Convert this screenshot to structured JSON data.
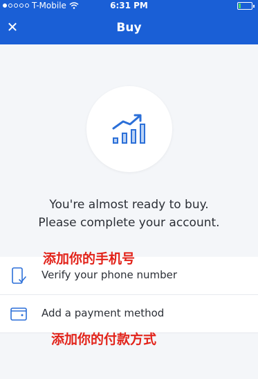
{
  "status_bar": {
    "carrier": "T-Mobile",
    "time": "6:31 PM"
  },
  "header": {
    "close_icon": "close-icon",
    "title": "Buy"
  },
  "hero_icon": "chart-growth-icon",
  "message": {
    "line1": "You're almost ready to buy.",
    "line2": "Please complete your account."
  },
  "annotations": {
    "phone": "添加你的手机号",
    "payment": "添加你的付款方式"
  },
  "list": {
    "items": [
      {
        "icon": "phone-check-icon",
        "label": "Verify your phone number"
      },
      {
        "icon": "wallet-icon",
        "label": "Add a payment method"
      }
    ]
  },
  "colors": {
    "brand_blue": "#1a5fd6",
    "icon_blue": "#2b6fd8",
    "annotation_red": "#e2231a",
    "background": "#f4f6f9"
  }
}
